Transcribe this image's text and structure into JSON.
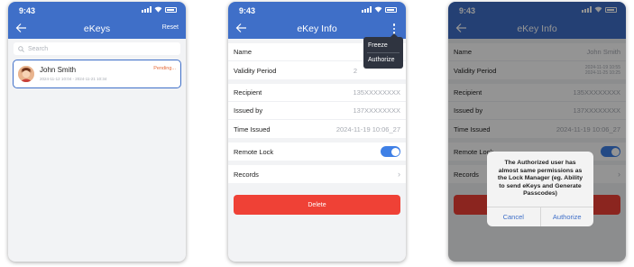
{
  "colors": {
    "header": "#3f6fc8",
    "accent": "#3f80e6",
    "danger": "#ef4136",
    "pending": "#e56b3a"
  },
  "status": {
    "time": "9:43"
  },
  "screen1": {
    "title": "eKeys",
    "reset_label": "Reset",
    "search_placeholder": "Search",
    "items": [
      {
        "name": "John Smith",
        "period": "2024-11-12 10:04 - 2024-11-21 10:34",
        "status": "Pending..."
      }
    ]
  },
  "screen2": {
    "title": "eKey Info",
    "rows": {
      "name_label": "Name",
      "validity_label": "Validity Period",
      "validity_value": "2",
      "recipient_label": "Recipient",
      "recipient_value": "135XXXXXXXX",
      "issued_by_label": "Issued by",
      "issued_by_value": "137XXXXXXXX",
      "time_issued_label": "Time Issued",
      "time_issued_value": "2024-11-19 10:06_27",
      "remote_lock_label": "Remote Lock",
      "records_label": "Records"
    },
    "remote_lock_on": true,
    "delete_label": "Delete",
    "menu": {
      "freeze": "Freeze",
      "authorize": "Authorize"
    }
  },
  "screen3": {
    "title": "eKey Info",
    "rows": {
      "name_label": "Name",
      "name_value": "John Smith",
      "validity_label": "Validity Period",
      "validity_value_1": "2024-11-19 10:55",
      "validity_value_2": "2024-11-25 10:25",
      "recipient_label": "Recipient",
      "recipient_value": "135XXXXXXXX",
      "issued_by_label": "Issued by",
      "issued_by_value": "137XXXXXXXX",
      "time_issued_label": "Time Issued",
      "time_issued_value": "2024-11-19 10:06_27",
      "remote_lock_label": "Remote Lock",
      "records_label": "Records"
    },
    "dialog": {
      "message": "The Authorized user has almost same permissions as the Lock Manager (eg. Ability to send eKeys and Generate Passcodes)",
      "cancel": "Cancel",
      "authorize": "Authorize"
    }
  }
}
